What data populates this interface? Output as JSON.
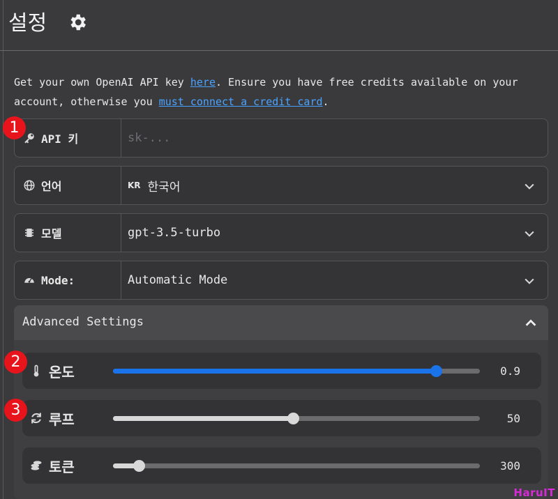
{
  "header": {
    "title": "설정",
    "icon": "gear-icon"
  },
  "intro": {
    "part1": "Get your own OpenAI API key ",
    "link1": "here",
    "part2": ". Ensure you have free credits available on your account, otherwise you ",
    "link2": "must connect a credit card",
    "part3": "."
  },
  "fields": {
    "api_key": {
      "label": "API 키",
      "placeholder": "sk-...",
      "icon": "key-icon"
    },
    "language": {
      "label": "언어",
      "flag": "KR",
      "value": "한국어",
      "icon": "globe-icon"
    },
    "model": {
      "label": "모델",
      "value": "gpt-3.5-turbo",
      "icon": "chip-icon"
    },
    "mode": {
      "label": "Mode:",
      "value": "Automatic Mode",
      "icon": "gauge-icon"
    }
  },
  "advanced": {
    "title": "Advanced Settings",
    "expanded": true
  },
  "sliders": [
    {
      "label": "온도",
      "value": "0.9",
      "fraction": 0.88,
      "icon": "thermometer-icon",
      "color": "#1a73e8"
    },
    {
      "label": "루프",
      "value": "50",
      "fraction": 0.49,
      "icon": "loop-icon",
      "color": "#d8d8d8"
    },
    {
      "label": "토큰",
      "value": "300",
      "fraction": 0.07,
      "icon": "coins-icon",
      "color": "#d8d8d8"
    }
  ],
  "badges": [
    "1",
    "2",
    "3"
  ],
  "watermark": "HaruIT",
  "colors": {
    "accent": "#1a73e8",
    "link": "#4aa3ff",
    "badge": "#e8141c"
  }
}
